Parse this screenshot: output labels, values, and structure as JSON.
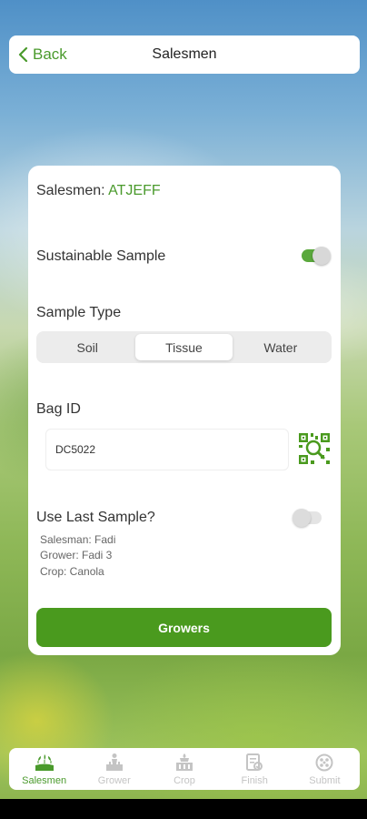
{
  "header": {
    "back_label": "Back",
    "title": "Salesmen"
  },
  "card": {
    "salesmen_label": "Salesmen:",
    "salesmen_value": "ATJEFF",
    "sustainable_label": "Sustainable Sample",
    "sustainable_on": true,
    "sample_type_label": "Sample Type",
    "sample_types": [
      "Soil",
      "Tissue",
      "Water"
    ],
    "sample_type_selected": "Tissue",
    "bag_id_label": "Bag ID",
    "bag_id_value": "DC5022",
    "use_last_label": "Use Last Sample?",
    "use_last_on": false,
    "last_salesman": "Salesman: Fadi",
    "last_grower": "Grower: Fadi 3",
    "last_crop": "Crop: Canola",
    "growers_button": "Growers"
  },
  "tabs": [
    {
      "label": "Salesmen",
      "icon": "sprout-icon",
      "active": true
    },
    {
      "label": "Grower",
      "icon": "grower-icon",
      "active": false
    },
    {
      "label": "Crop",
      "icon": "crop-icon",
      "active": false
    },
    {
      "label": "Finish",
      "icon": "finish-icon",
      "active": false
    },
    {
      "label": "Submit",
      "icon": "submit-icon",
      "active": false
    }
  ],
  "colors": {
    "accent": "#4a9a2c",
    "button": "#4a9a1e",
    "inactive": "#c4c4c4"
  }
}
